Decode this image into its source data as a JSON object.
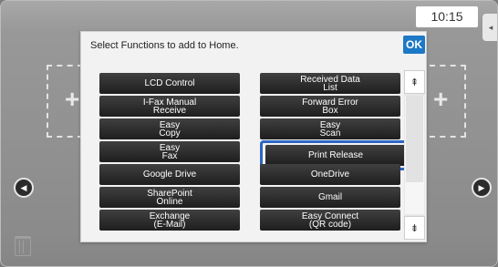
{
  "status": {
    "time": "10:15",
    "side_tab_glyph": "◂"
  },
  "dialog": {
    "title": "Select Functions to add to Home.",
    "ok_label": "OK",
    "functions": [
      {
        "label": "LCD Control",
        "selected": false
      },
      {
        "label": "Received Data\nList",
        "selected": false
      },
      {
        "label": "I-Fax Manual\nReceive",
        "selected": false
      },
      {
        "label": "Forward Error\nBox",
        "selected": false
      },
      {
        "label": "Easy\nCopy",
        "selected": false
      },
      {
        "label": "Easy\nScan",
        "selected": false
      },
      {
        "label": "Easy\nFax",
        "selected": false
      },
      {
        "label": "Print Release",
        "selected": true
      },
      {
        "label": "Google Drive",
        "selected": false
      },
      {
        "label": "OneDrive",
        "selected": false
      },
      {
        "label": "SharePoint\nOnline",
        "selected": false
      },
      {
        "label": "Gmail",
        "selected": false
      },
      {
        "label": "Exchange\n(E-Mail)",
        "selected": false
      },
      {
        "label": "Easy Connect\n(QR code)",
        "selected": false
      }
    ],
    "scroll_up_glyph": "⇞",
    "scroll_down_glyph": "⇟"
  },
  "background": {
    "plus_glyph": "+",
    "left_arrow_glyph": "◀",
    "right_arrow_glyph": "▶"
  },
  "colors": {
    "accent": "#1d78c6",
    "selection": "#2c67c4",
    "button_dark": "#2a2a2a"
  }
}
